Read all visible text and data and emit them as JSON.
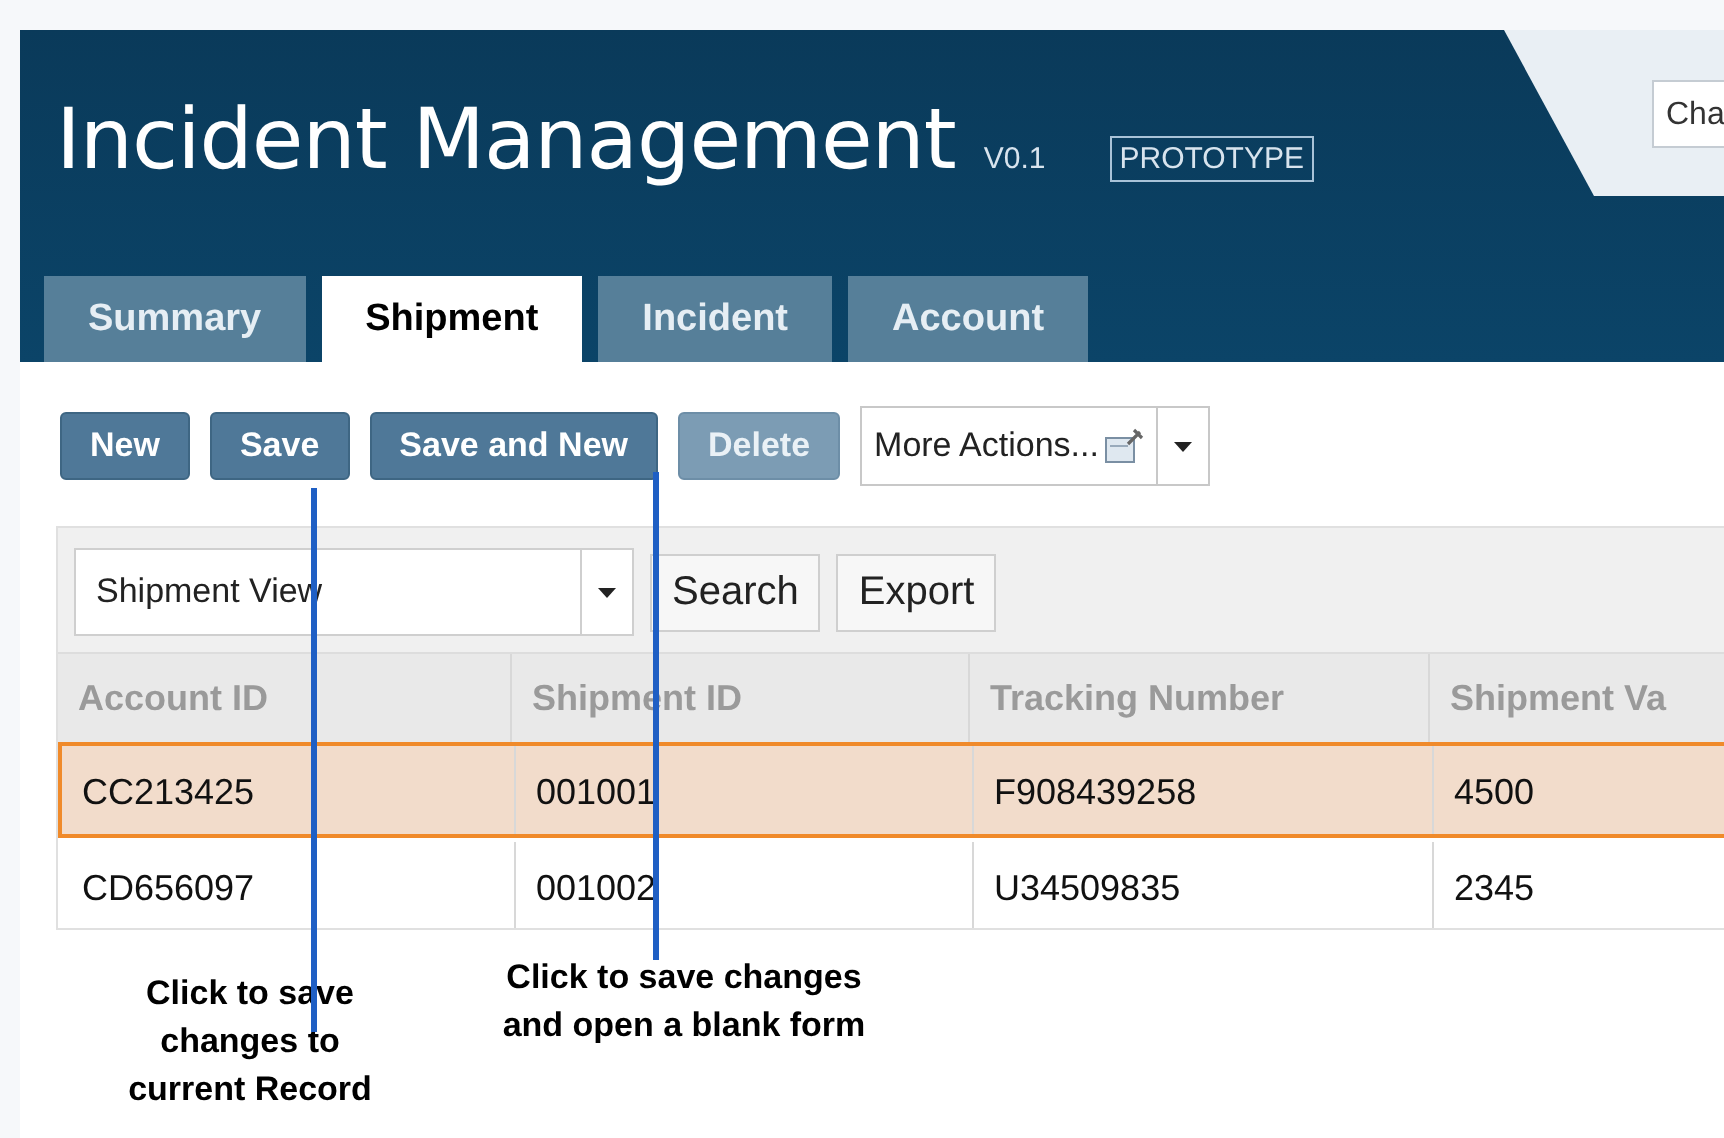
{
  "header": {
    "title": "Incident Management",
    "version": "V0.1",
    "badge": "PROTOTYPE",
    "search": {
      "value": "Cha"
    }
  },
  "tabs": [
    {
      "label": "Summary",
      "selected": false
    },
    {
      "label": "Shipment",
      "selected": true
    },
    {
      "label": "Incident",
      "selected": false
    },
    {
      "label": "Account",
      "selected": false
    }
  ],
  "toolbar": {
    "buttons": [
      {
        "label": "New",
        "disabled": false
      },
      {
        "label": "Save",
        "disabled": false
      },
      {
        "label": "Save and New",
        "disabled": false
      },
      {
        "label": "Delete",
        "disabled": true
      }
    ],
    "more_actions": {
      "label": "More Actions..."
    }
  },
  "grid": {
    "view": {
      "value": "Shipment View"
    },
    "buttons": [
      "Search",
      "Export"
    ],
    "columns": [
      "Account ID",
      "Shipment ID",
      "Tracking Number",
      "Shipment Va"
    ],
    "rows": [
      {
        "cells": [
          "CC213425",
          "001001",
          "F908439258",
          "4500"
        ],
        "selected": true
      },
      {
        "cells": [
          "CD656097",
          "001002",
          "U34509835",
          "2345"
        ],
        "selected": false
      }
    ]
  },
  "callouts": [
    "Click to save changes to current Record",
    "Click to save changes and open a blank form"
  ]
}
